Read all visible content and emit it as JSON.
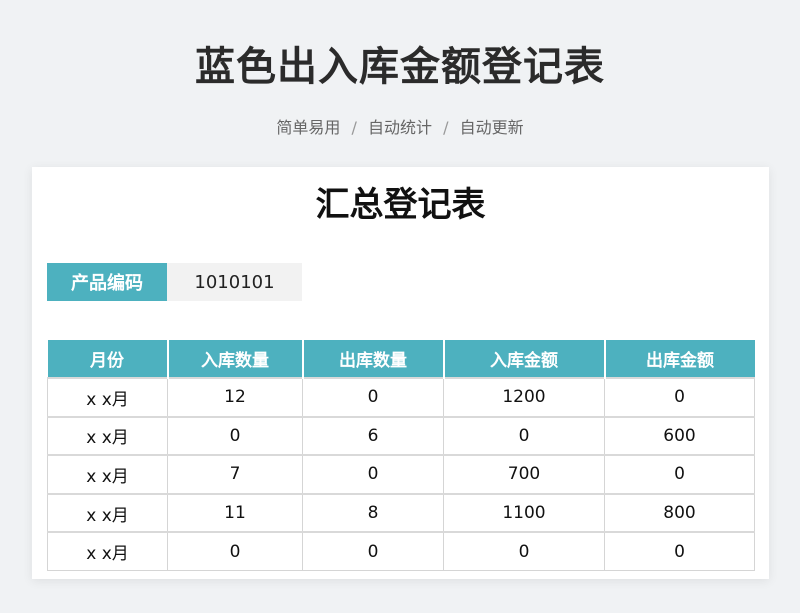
{
  "header": {
    "title": "蓝色出入库金额登记表",
    "tagline": [
      "简单易用",
      "自动统计",
      "自动更新"
    ],
    "tagline_separator": "/"
  },
  "card": {
    "title": "汇总登记表",
    "product_code_label": "产品编码",
    "product_code_value": "1010101"
  },
  "table": {
    "columns": [
      "月份",
      "入库数量",
      "出库数量",
      "入库金额",
      "出库金额"
    ],
    "rows": [
      [
        "x x月",
        "12",
        "0",
        "1200",
        "0"
      ],
      [
        "x x月",
        "0",
        "6",
        "0",
        "600"
      ],
      [
        "x x月",
        "7",
        "0",
        "700",
        "0"
      ],
      [
        "x x月",
        "11",
        "8",
        "1100",
        "800"
      ],
      [
        "x x月",
        "0",
        "0",
        "0",
        "0"
      ]
    ]
  },
  "colors": {
    "accent": "#4db1bf",
    "background": "#f0f2f4",
    "code_value_bg": "#f2f2f2"
  }
}
